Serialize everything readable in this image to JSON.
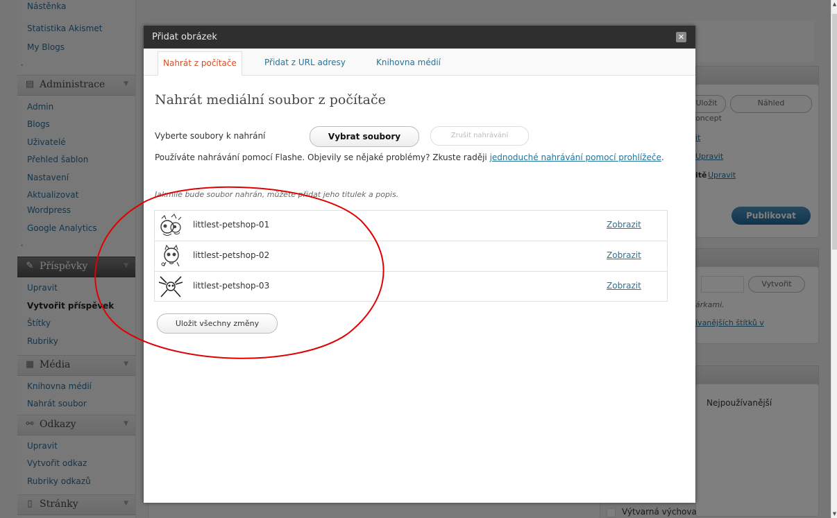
{
  "sidebar": {
    "top_links": [
      "Nástěnka",
      "Statistika Akismet",
      "My Blogs"
    ],
    "administrace": {
      "label": "Administrace",
      "icon": "admin-icon",
      "items": [
        "Admin",
        "Blogs",
        "Uživatelé",
        "Přehled šablon",
        "Nastavení",
        "Aktualizovat",
        "Wordpress",
        "Google Analytics"
      ]
    },
    "prispevky": {
      "label": "Příspěvky",
      "icon": "pin-icon",
      "items": [
        "Upravit",
        "Vytvořit příspěvek",
        "Štítky",
        "Rubriky"
      ]
    },
    "media": {
      "label": "Média",
      "icon": "media-icon",
      "items": [
        "Knihovna médií",
        "Nahrát soubor"
      ]
    },
    "odkazy": {
      "label": "Odkazy",
      "icon": "links-icon",
      "items": [
        "Upravit",
        "Vytvořit odkaz",
        "Rubriky odkazů"
      ]
    },
    "stranky": {
      "label": "Stránky",
      "icon": "pages-icon"
    }
  },
  "background": {
    "draft_label": "Uložit koncept",
    "preview_label": "Náhled",
    "edit_link": "Upravit",
    "edit_link2": "Upravit",
    "visibility_text": "itě",
    "publish_label": "Publikovat",
    "create_label": "Vytvořit",
    "tags_hint": "árkami.",
    "tags_link": "ívanějších štítků v",
    "most_used": "Nejpoužívanější",
    "category_item": "Výtvarná výchova"
  },
  "dialog": {
    "title": "Přidat obrázek",
    "tabs": [
      {
        "label": "Nahrát z počítače",
        "active": true
      },
      {
        "label": "Přidat z URL adresy",
        "active": false
      },
      {
        "label": "Knihovna médií",
        "active": false
      }
    ],
    "heading": "Nahrát mediální soubor z počítače",
    "select_label": "Vyberte soubory k nahrání",
    "select_button": "Vybrat soubory",
    "cancel_button": "Zrušit nahrávání",
    "flash_text_before": "Používáte nahrávání pomocí Flashe. Objevily se nějaké problémy? Zkuste raději ",
    "flash_link": "jednoduché nahrávání pomocí prohlížeče",
    "flash_text_after": ".",
    "note": "Jakmile bude soubor nahrán, můžete přidat jeho titulek a popis.",
    "files": [
      {
        "name": "littlest-petshop-01",
        "action": "Zobrazit"
      },
      {
        "name": "littlest-petshop-02",
        "action": "Zobrazit"
      },
      {
        "name": "littlest-petshop-03",
        "action": "Zobrazit"
      }
    ],
    "save_all": "Uložit všechny změny"
  },
  "colors": {
    "link": "#21759b",
    "active_tab": "#d54e21",
    "title_bar": "#2f2f2f",
    "annotation": "#e00000"
  }
}
